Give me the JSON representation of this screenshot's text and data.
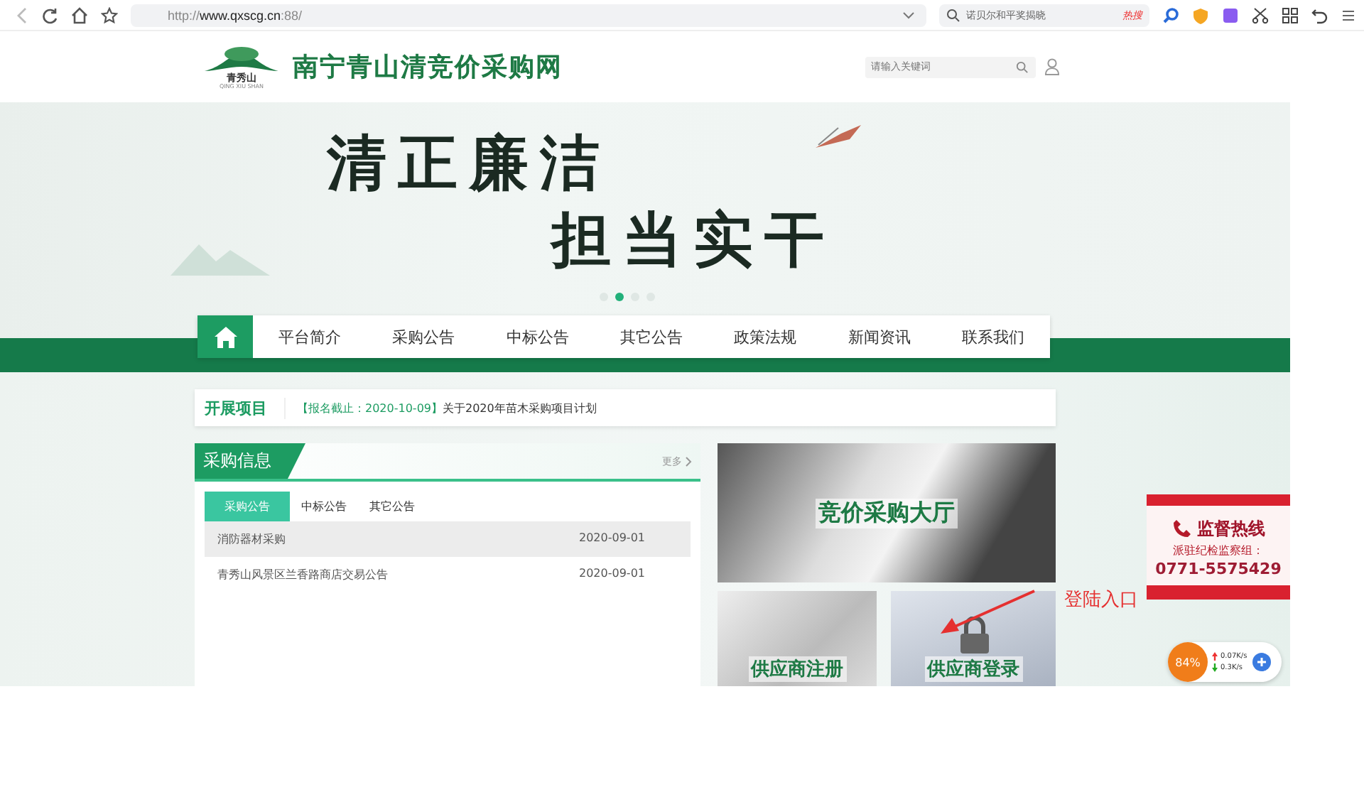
{
  "browser": {
    "url_scheme": "http://",
    "url_host": "www.qxscg.cn",
    "url_port": ":88/",
    "search_placeholder": "诺贝尔和平奖揭晓",
    "hot_badge": "热搜"
  },
  "header": {
    "logo_cn": "青秀山",
    "logo_en": "QING XIU SHAN",
    "site_title": "南宁青山清竞价采购网",
    "search_placeholder": "请输入关键词"
  },
  "banner": {
    "lines": [
      "清正廉洁",
      "担当实干"
    ],
    "dots": [
      {
        "selected": false
      },
      {
        "selected": true
      },
      {
        "selected": false
      },
      {
        "selected": false
      }
    ]
  },
  "nav": [
    {
      "kind": "home"
    },
    {
      "kind": "text",
      "label": "平台简介"
    },
    {
      "kind": "text",
      "label": "采购公告"
    },
    {
      "kind": "text",
      "label": "中标公告"
    },
    {
      "kind": "text",
      "label": "其它公告"
    },
    {
      "kind": "text",
      "label": "政策法规"
    },
    {
      "kind": "text",
      "label": "新闻资讯"
    },
    {
      "kind": "text",
      "label": "联系我们"
    }
  ],
  "projects": {
    "title": "开展项目",
    "deadline": "【报名截止：2020-10-09】",
    "item": "关于2020年苗木采购项目计划"
  },
  "procurement": {
    "title": "采购信息",
    "more": "更多",
    "tabs": [
      {
        "label": "采购公告",
        "selected": true
      },
      {
        "label": "中标公告",
        "selected": false
      },
      {
        "label": "其它公告",
        "selected": false
      }
    ],
    "rows": [
      {
        "title": "消防器材采购",
        "date": "2020-09-01",
        "highlighted": true
      },
      {
        "title": "青秀山风景区兰香路商店交易公告",
        "date": "2020-09-01",
        "highlighted": false
      }
    ]
  },
  "tiles": {
    "hall": "竞价采购大厅",
    "register": "供应商注册",
    "login": "供应商登录"
  },
  "annotation": "登陆入口",
  "hotline": {
    "title": "监督热线",
    "label": "派驻纪检监察组：",
    "phone": "0771-5575429"
  },
  "speed_widget": {
    "percent": "84%",
    "up": "0.07K/s",
    "down": "0.3K/s"
  }
}
